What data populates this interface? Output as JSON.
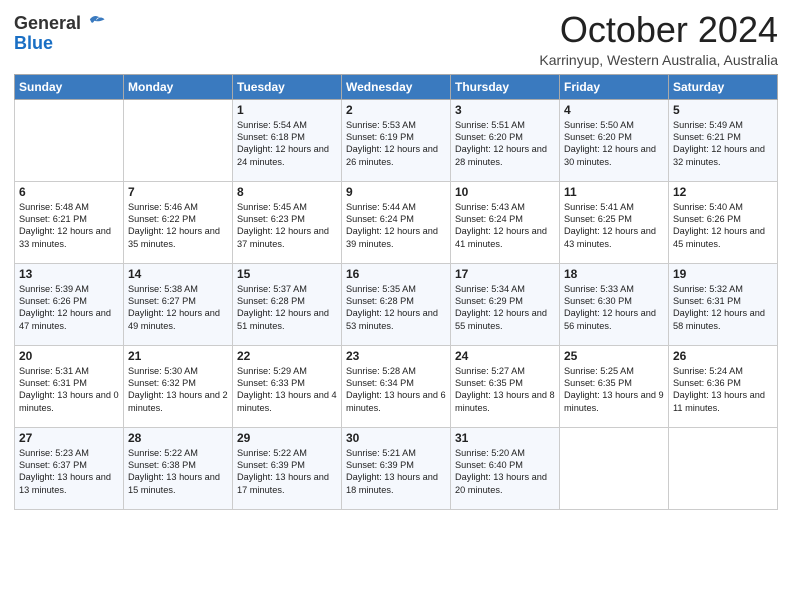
{
  "header": {
    "logo_general": "General",
    "logo_blue": "Blue",
    "title": "October 2024",
    "subtitle": "Karrinyup, Western Australia, Australia"
  },
  "days_of_week": [
    "Sunday",
    "Monday",
    "Tuesday",
    "Wednesday",
    "Thursday",
    "Friday",
    "Saturday"
  ],
  "weeks": [
    [
      {
        "day": "",
        "text": ""
      },
      {
        "day": "",
        "text": ""
      },
      {
        "day": "1",
        "text": "Sunrise: 5:54 AM\nSunset: 6:18 PM\nDaylight: 12 hours and 24 minutes."
      },
      {
        "day": "2",
        "text": "Sunrise: 5:53 AM\nSunset: 6:19 PM\nDaylight: 12 hours and 26 minutes."
      },
      {
        "day": "3",
        "text": "Sunrise: 5:51 AM\nSunset: 6:20 PM\nDaylight: 12 hours and 28 minutes."
      },
      {
        "day": "4",
        "text": "Sunrise: 5:50 AM\nSunset: 6:20 PM\nDaylight: 12 hours and 30 minutes."
      },
      {
        "day": "5",
        "text": "Sunrise: 5:49 AM\nSunset: 6:21 PM\nDaylight: 12 hours and 32 minutes."
      }
    ],
    [
      {
        "day": "6",
        "text": "Sunrise: 5:48 AM\nSunset: 6:21 PM\nDaylight: 12 hours and 33 minutes."
      },
      {
        "day": "7",
        "text": "Sunrise: 5:46 AM\nSunset: 6:22 PM\nDaylight: 12 hours and 35 minutes."
      },
      {
        "day": "8",
        "text": "Sunrise: 5:45 AM\nSunset: 6:23 PM\nDaylight: 12 hours and 37 minutes."
      },
      {
        "day": "9",
        "text": "Sunrise: 5:44 AM\nSunset: 6:24 PM\nDaylight: 12 hours and 39 minutes."
      },
      {
        "day": "10",
        "text": "Sunrise: 5:43 AM\nSunset: 6:24 PM\nDaylight: 12 hours and 41 minutes."
      },
      {
        "day": "11",
        "text": "Sunrise: 5:41 AM\nSunset: 6:25 PM\nDaylight: 12 hours and 43 minutes."
      },
      {
        "day": "12",
        "text": "Sunrise: 5:40 AM\nSunset: 6:26 PM\nDaylight: 12 hours and 45 minutes."
      }
    ],
    [
      {
        "day": "13",
        "text": "Sunrise: 5:39 AM\nSunset: 6:26 PM\nDaylight: 12 hours and 47 minutes."
      },
      {
        "day": "14",
        "text": "Sunrise: 5:38 AM\nSunset: 6:27 PM\nDaylight: 12 hours and 49 minutes."
      },
      {
        "day": "15",
        "text": "Sunrise: 5:37 AM\nSunset: 6:28 PM\nDaylight: 12 hours and 51 minutes."
      },
      {
        "day": "16",
        "text": "Sunrise: 5:35 AM\nSunset: 6:28 PM\nDaylight: 12 hours and 53 minutes."
      },
      {
        "day": "17",
        "text": "Sunrise: 5:34 AM\nSunset: 6:29 PM\nDaylight: 12 hours and 55 minutes."
      },
      {
        "day": "18",
        "text": "Sunrise: 5:33 AM\nSunset: 6:30 PM\nDaylight: 12 hours and 56 minutes."
      },
      {
        "day": "19",
        "text": "Sunrise: 5:32 AM\nSunset: 6:31 PM\nDaylight: 12 hours and 58 minutes."
      }
    ],
    [
      {
        "day": "20",
        "text": "Sunrise: 5:31 AM\nSunset: 6:31 PM\nDaylight: 13 hours and 0 minutes."
      },
      {
        "day": "21",
        "text": "Sunrise: 5:30 AM\nSunset: 6:32 PM\nDaylight: 13 hours and 2 minutes."
      },
      {
        "day": "22",
        "text": "Sunrise: 5:29 AM\nSunset: 6:33 PM\nDaylight: 13 hours and 4 minutes."
      },
      {
        "day": "23",
        "text": "Sunrise: 5:28 AM\nSunset: 6:34 PM\nDaylight: 13 hours and 6 minutes."
      },
      {
        "day": "24",
        "text": "Sunrise: 5:27 AM\nSunset: 6:35 PM\nDaylight: 13 hours and 8 minutes."
      },
      {
        "day": "25",
        "text": "Sunrise: 5:25 AM\nSunset: 6:35 PM\nDaylight: 13 hours and 9 minutes."
      },
      {
        "day": "26",
        "text": "Sunrise: 5:24 AM\nSunset: 6:36 PM\nDaylight: 13 hours and 11 minutes."
      }
    ],
    [
      {
        "day": "27",
        "text": "Sunrise: 5:23 AM\nSunset: 6:37 PM\nDaylight: 13 hours and 13 minutes."
      },
      {
        "day": "28",
        "text": "Sunrise: 5:22 AM\nSunset: 6:38 PM\nDaylight: 13 hours and 15 minutes."
      },
      {
        "day": "29",
        "text": "Sunrise: 5:22 AM\nSunset: 6:39 PM\nDaylight: 13 hours and 17 minutes."
      },
      {
        "day": "30",
        "text": "Sunrise: 5:21 AM\nSunset: 6:39 PM\nDaylight: 13 hours and 18 minutes."
      },
      {
        "day": "31",
        "text": "Sunrise: 5:20 AM\nSunset: 6:40 PM\nDaylight: 13 hours and 20 minutes."
      },
      {
        "day": "",
        "text": ""
      },
      {
        "day": "",
        "text": ""
      }
    ]
  ]
}
